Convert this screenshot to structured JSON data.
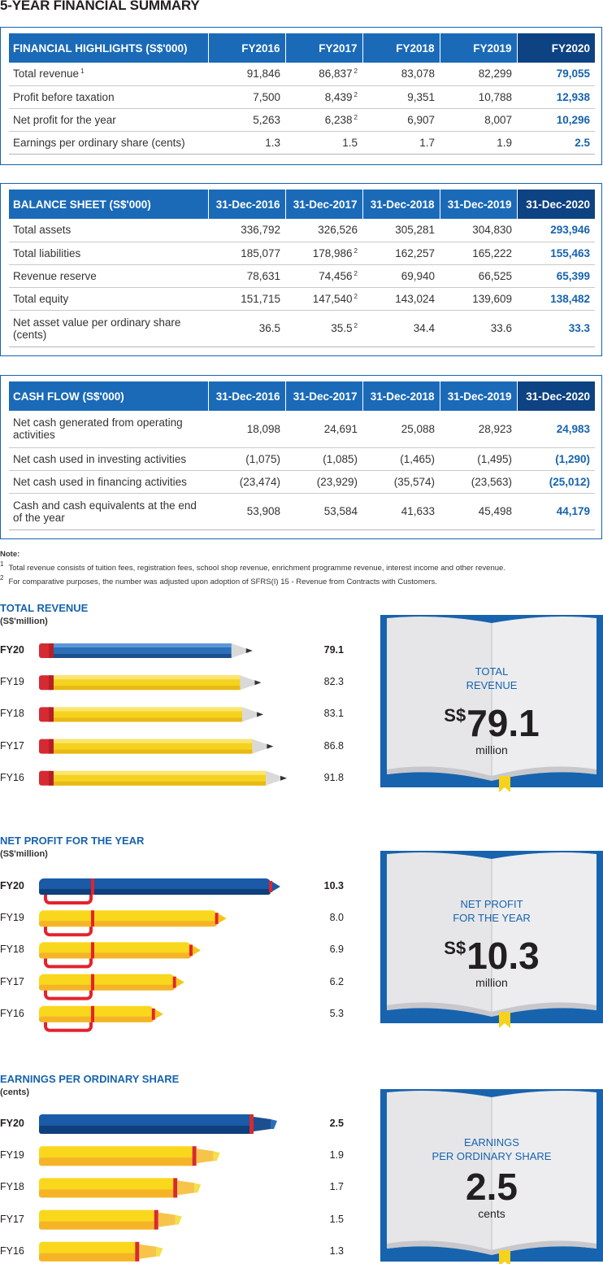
{
  "page_title": "5-YEAR FINANCIAL SUMMARY",
  "colors": {
    "accent_blue": "#1a6ab8",
    "dark_blue": "#0d4283",
    "pencil_yellow": "#f5d21f",
    "eraser_red": "#d62a33"
  },
  "tables": {
    "highlights": {
      "title": "FINANCIAL HIGHLIGHTS (S$'000)",
      "columns": [
        "FY2016",
        "FY2017",
        "FY2018",
        "FY2019",
        "FY2020"
      ],
      "rows": [
        {
          "label": "Total revenue",
          "sup": "1",
          "values": [
            "91,846",
            "86,837",
            "83,078",
            "82,299",
            "79,055"
          ],
          "sups": [
            "",
            "2",
            "",
            "",
            ""
          ]
        },
        {
          "label": "Profit before taxation",
          "sup": "",
          "values": [
            "7,500",
            "8,439",
            "9,351",
            "10,788",
            "12,938"
          ],
          "sups": [
            "",
            "2",
            "",
            "",
            ""
          ]
        },
        {
          "label": "Net profit for the year",
          "sup": "",
          "values": [
            "5,263",
            "6,238",
            "6,907",
            "8,007",
            "10,296"
          ],
          "sups": [
            "",
            "2",
            "",
            "",
            ""
          ]
        },
        {
          "label": "Earnings per ordinary share (cents)",
          "sup": "",
          "values": [
            "1.3",
            "1.5",
            "1.7",
            "1.9",
            "2.5"
          ],
          "sups": [
            "",
            "",
            "",
            "",
            ""
          ]
        }
      ]
    },
    "balance": {
      "title": "BALANCE SHEET (S$'000)",
      "columns": [
        "31-Dec-2016",
        "31-Dec-2017",
        "31-Dec-2018",
        "31-Dec-2019",
        "31-Dec-2020"
      ],
      "rows": [
        {
          "label": "Total assets",
          "sup": "",
          "values": [
            "336,792",
            "326,526",
            "305,281",
            "304,830",
            "293,946"
          ],
          "sups": [
            "",
            "",
            "",
            "",
            ""
          ]
        },
        {
          "label": "Total liabilities",
          "sup": "",
          "values": [
            "185,077",
            "178,986",
            "162,257",
            "165,222",
            "155,463"
          ],
          "sups": [
            "",
            "2",
            "",
            "",
            ""
          ]
        },
        {
          "label": "Revenue reserve",
          "sup": "",
          "values": [
            "78,631",
            "74,456",
            "69,940",
            "66,525",
            "65,399"
          ],
          "sups": [
            "",
            "2",
            "",
            "",
            ""
          ]
        },
        {
          "label": "Total equity",
          "sup": "",
          "values": [
            "151,715",
            "147,540",
            "143,024",
            "139,609",
            "138,482"
          ],
          "sups": [
            "",
            "2",
            "",
            "",
            ""
          ]
        },
        {
          "label": "Net asset value per ordinary share (cents)",
          "sup": "",
          "values": [
            "36.5",
            "35.5",
            "34.4",
            "33.6",
            "33.3"
          ],
          "sups": [
            "",
            "2",
            "",
            "",
            ""
          ]
        }
      ]
    },
    "cashflow": {
      "title": "CASH FLOW (S$'000)",
      "columns": [
        "31-Dec-2016",
        "31-Dec-2017",
        "31-Dec-2018",
        "31-Dec-2019",
        "31-Dec-2020"
      ],
      "rows": [
        {
          "label": "Net cash generated from operating activities",
          "sup": "",
          "values": [
            "18,098",
            "24,691",
            "25,088",
            "28,923",
            "24,983"
          ],
          "sups": [
            "",
            "",
            "",
            "",
            ""
          ]
        },
        {
          "label": "Net cash used in investing activities",
          "sup": "",
          "values": [
            "(1,075)",
            "(1,085)",
            "(1,465)",
            "(1,495)",
            "(1,290)"
          ],
          "sups": [
            "",
            "",
            "",
            "",
            ""
          ]
        },
        {
          "label": "Net cash used in financing activities",
          "sup": "",
          "values": [
            "(23,474)",
            "(23,929)",
            "(35,574)",
            "(23,563)",
            "(25,012)"
          ],
          "sups": [
            "",
            "",
            "",
            "",
            ""
          ]
        },
        {
          "label": "Cash and cash equivalents at the end of the year",
          "sup": "",
          "values": [
            "53,908",
            "53,584",
            "41,633",
            "45,498",
            "44,179"
          ],
          "sups": [
            "",
            "",
            "",
            "",
            ""
          ]
        }
      ]
    }
  },
  "notes": {
    "label": "Note:",
    "items": [
      {
        "mark": "1",
        "text": "Total revenue consists of tuition fees, registration fees, school shop revenue, enrichment programme revenue, interest income and other revenue."
      },
      {
        "mark": "2",
        "text": "For comparative purposes, the number was adjusted upon adoption of SFRS(I) 15 - Revenue from Contracts with Customers."
      }
    ]
  },
  "chart_data": [
    {
      "type": "bar",
      "title": "TOTAL REVENUE",
      "subtitle": "(S$'million)",
      "categories": [
        "FY20",
        "FY19",
        "FY18",
        "FY17",
        "FY16"
      ],
      "values": [
        79.1,
        82.3,
        83.1,
        86.8,
        91.8
      ],
      "value_labels": [
        "79.1",
        "82.3",
        "83.1",
        "86.8",
        "91.8"
      ],
      "icon": "pencil",
      "highlight": {
        "caption_line1": "TOTAL",
        "caption_line2": "REVENUE",
        "currency": "S$",
        "value": "79.1",
        "unit": "million"
      }
    },
    {
      "type": "bar",
      "title": "NET PROFIT FOR THE YEAR",
      "subtitle": "(S$'million)",
      "categories": [
        "FY20",
        "FY19",
        "FY18",
        "FY17",
        "FY16"
      ],
      "values": [
        10.3,
        8.0,
        6.9,
        6.2,
        5.3
      ],
      "value_labels": [
        "10.3",
        "8.0",
        "6.9",
        "6.2",
        "5.3"
      ],
      "icon": "pen",
      "highlight": {
        "caption_line1": "NET PROFIT",
        "caption_line2": "FOR THE YEAR",
        "currency": "S$",
        "value": "10.3",
        "unit": "million"
      }
    },
    {
      "type": "bar",
      "title": "EARNINGS PER ORDINARY SHARE",
      "subtitle": "(cents)",
      "categories": [
        "FY20",
        "FY19",
        "FY18",
        "FY17",
        "FY16"
      ],
      "values": [
        2.5,
        1.9,
        1.7,
        1.5,
        1.3
      ],
      "value_labels": [
        "2.5",
        "1.9",
        "1.7",
        "1.5",
        "1.3"
      ],
      "icon": "highlighter",
      "highlight": {
        "caption_line1": "EARNINGS",
        "caption_line2": "PER ORDINARY SHARE",
        "currency": "",
        "value": "2.5",
        "unit": "cents"
      }
    }
  ]
}
